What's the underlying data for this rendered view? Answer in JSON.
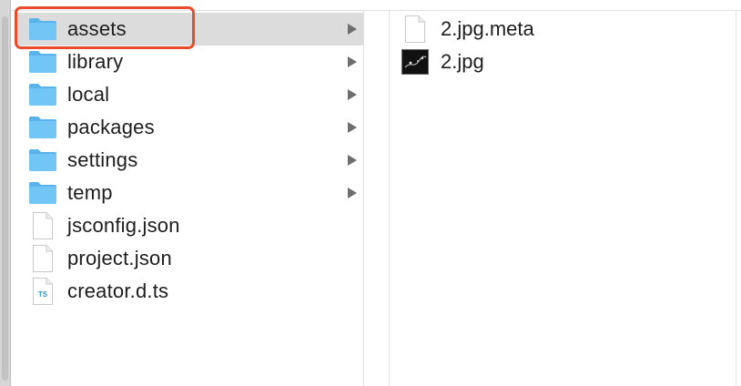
{
  "columns": {
    "project": {
      "items": [
        {
          "label": "assets",
          "type": "folder",
          "has_children": true,
          "selected": true
        },
        {
          "label": "library",
          "type": "folder",
          "has_children": true
        },
        {
          "label": "local",
          "type": "folder",
          "has_children": true
        },
        {
          "label": "packages",
          "type": "folder",
          "has_children": true
        },
        {
          "label": "settings",
          "type": "folder",
          "has_children": true
        },
        {
          "label": "temp",
          "type": "folder",
          "has_children": true
        },
        {
          "label": "jsconfig.json",
          "type": "file"
        },
        {
          "label": "project.json",
          "type": "file"
        },
        {
          "label": "creator.d.ts",
          "type": "ts-file",
          "badge": "TS"
        }
      ]
    },
    "assets": {
      "items": [
        {
          "label": "2.jpg.meta",
          "type": "file"
        },
        {
          "label": "2.jpg",
          "type": "image"
        }
      ]
    }
  },
  "colors": {
    "folder": "#6cc1f4",
    "folder_tab": "#5ab3ea",
    "selection": "#dcdcdc",
    "highlight": "#ea4b2c",
    "ts_badge": "#3b8fc4"
  },
  "icons": {
    "folder": "folder-icon",
    "file": "document-icon",
    "ts": "typescript-file-icon",
    "image": "image-thumbnail-icon",
    "disclosure": "chevron-right-icon"
  }
}
